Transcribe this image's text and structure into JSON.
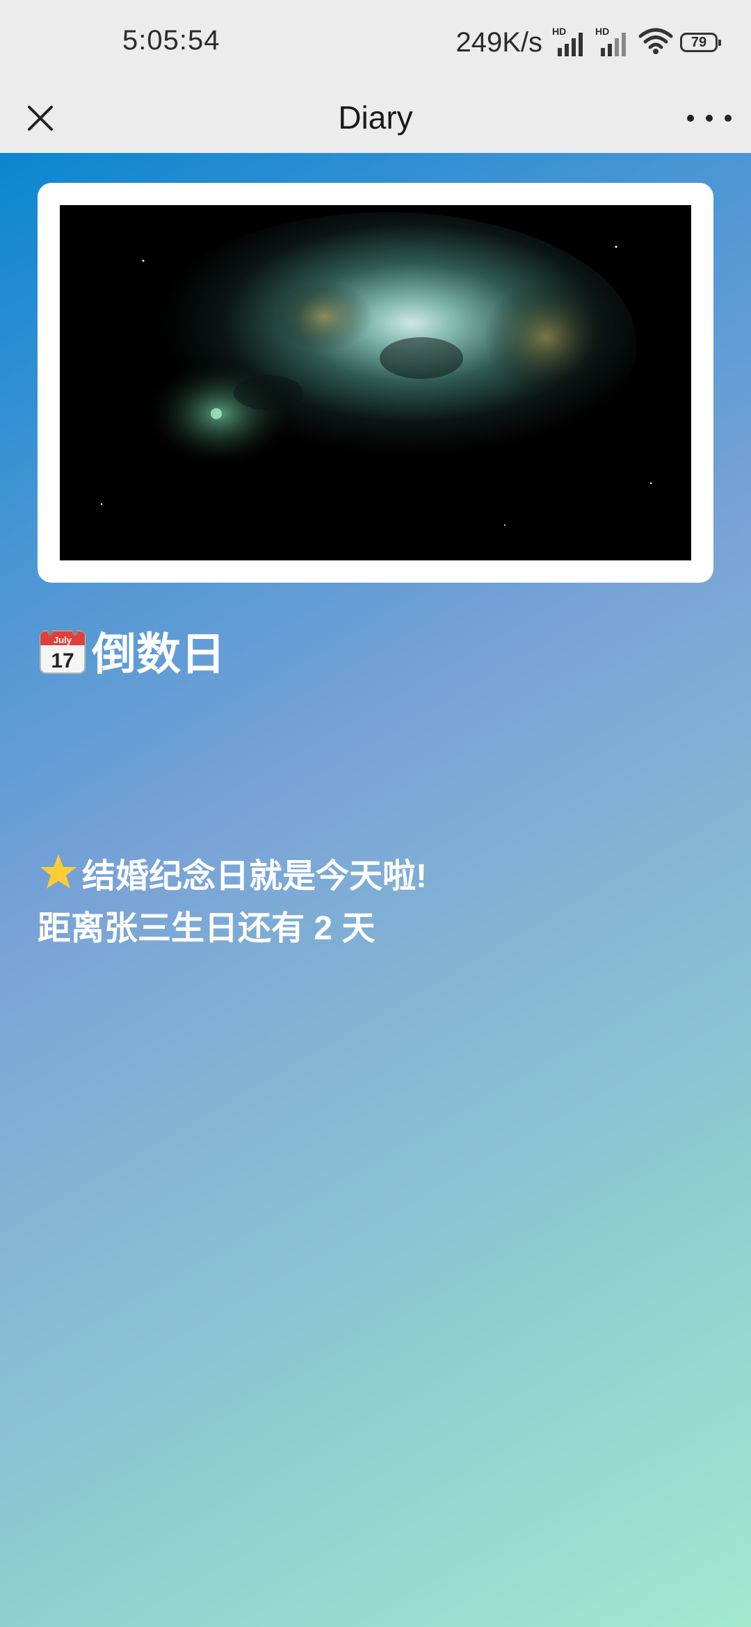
{
  "status_bar": {
    "time": "5:05:54",
    "net_speed": "249K/s",
    "sim1_label": "HD",
    "sim2_label": "HD",
    "battery": "79"
  },
  "nav": {
    "title": "Diary"
  },
  "diary": {
    "heading": "倒数日",
    "line1": "结婚纪念日就是今天啦!",
    "line2": "距离张三生日还有 2 天",
    "calendar_month": "July",
    "calendar_day": "17"
  },
  "colors": {
    "header_bg": "#ececec",
    "gradient_start": "#0b86d0",
    "gradient_end": "#a3e8cf",
    "text": "#ffffff"
  },
  "icons": {
    "close": "close-icon",
    "more": "more-icon",
    "calendar": "calendar-icon",
    "star": "star-icon",
    "wifi": "wifi-icon",
    "battery": "battery-icon"
  }
}
